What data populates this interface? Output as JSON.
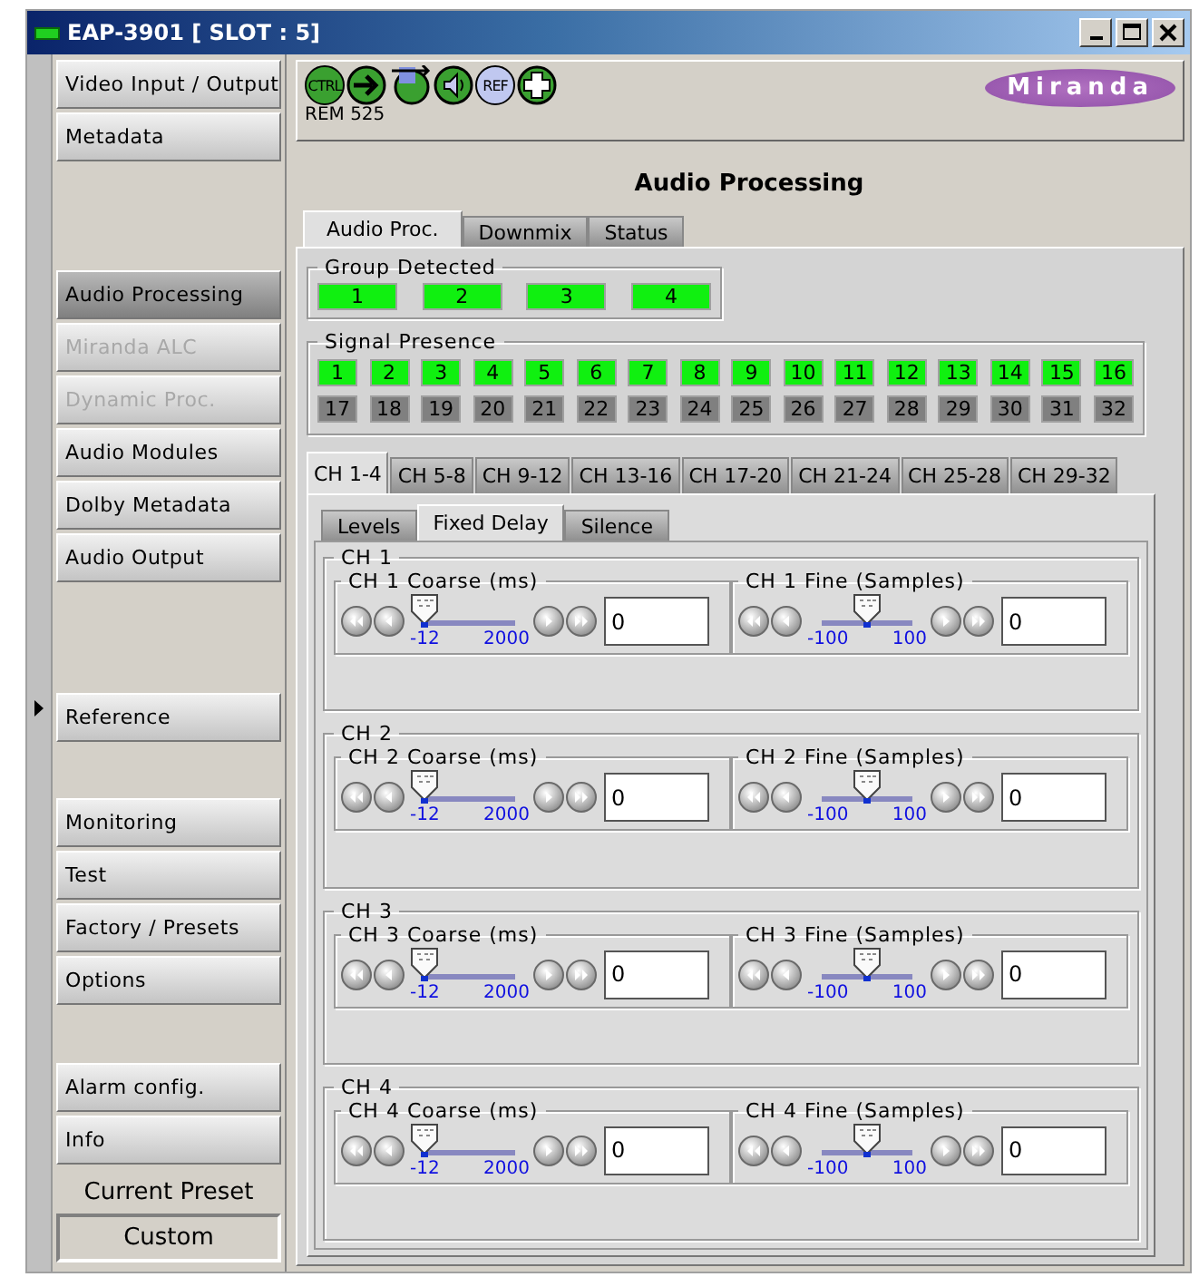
{
  "window": {
    "title": "EAP-3901 [ SLOT : 5]"
  },
  "toolbar": {
    "icons": [
      {
        "kind": "ctrl",
        "label": "CTRL"
      },
      {
        "kind": "arrow"
      },
      {
        "kind": "route"
      },
      {
        "kind": "speaker"
      },
      {
        "kind": "ref",
        "label": "REF"
      },
      {
        "kind": "plus"
      }
    ],
    "status": "REM 525",
    "logo": "Miranda"
  },
  "sidebar": {
    "groups": [
      [
        {
          "label": "Video Input / Output",
          "selected": false,
          "disabled": false
        },
        {
          "label": "Metadata",
          "selected": false,
          "disabled": false
        }
      ],
      [
        {
          "label": "Audio Processing",
          "selected": true,
          "disabled": false
        },
        {
          "label": "Miranda ALC",
          "selected": false,
          "disabled": true
        },
        {
          "label": "Dynamic Proc.",
          "selected": false,
          "disabled": true
        },
        {
          "label": "Audio Modules",
          "selected": false,
          "disabled": false
        },
        {
          "label": "Dolby Metadata",
          "selected": false,
          "disabled": false
        },
        {
          "label": "Audio Output",
          "selected": false,
          "disabled": false
        }
      ],
      [
        {
          "label": "Reference",
          "selected": false,
          "disabled": false
        }
      ],
      [
        {
          "label": "Monitoring",
          "selected": false,
          "disabled": false
        },
        {
          "label": "Test",
          "selected": false,
          "disabled": false
        },
        {
          "label": "Factory / Presets",
          "selected": false,
          "disabled": false
        },
        {
          "label": "Options",
          "selected": false,
          "disabled": false
        }
      ],
      [
        {
          "label": "Alarm config.",
          "selected": false,
          "disabled": false
        },
        {
          "label": "Info",
          "selected": false,
          "disabled": false
        }
      ]
    ],
    "preset_label": "Current Preset",
    "preset_value": "Custom"
  },
  "page_title": "Audio Processing",
  "tabs": [
    {
      "label": "Audio Proc.",
      "selected": true
    },
    {
      "label": "Downmix",
      "selected": false
    },
    {
      "label": "Status",
      "selected": false
    }
  ],
  "group_detected": {
    "title": "Group Detected",
    "items": [
      {
        "label": "1",
        "on": true
      },
      {
        "label": "2",
        "on": true
      },
      {
        "label": "3",
        "on": true
      },
      {
        "label": "4",
        "on": true
      }
    ]
  },
  "signal_presence": {
    "title": "Signal Presence",
    "items": [
      {
        "label": "1",
        "on": true
      },
      {
        "label": "2",
        "on": true
      },
      {
        "label": "3",
        "on": true
      },
      {
        "label": "4",
        "on": true
      },
      {
        "label": "5",
        "on": true
      },
      {
        "label": "6",
        "on": true
      },
      {
        "label": "7",
        "on": true
      },
      {
        "label": "8",
        "on": true
      },
      {
        "label": "9",
        "on": true
      },
      {
        "label": "10",
        "on": true
      },
      {
        "label": "11",
        "on": true
      },
      {
        "label": "12",
        "on": true
      },
      {
        "label": "13",
        "on": true
      },
      {
        "label": "14",
        "on": true
      },
      {
        "label": "15",
        "on": true
      },
      {
        "label": "16",
        "on": true
      },
      {
        "label": "17",
        "on": false
      },
      {
        "label": "18",
        "on": false
      },
      {
        "label": "19",
        "on": false
      },
      {
        "label": "20",
        "on": false
      },
      {
        "label": "21",
        "on": false
      },
      {
        "label": "22",
        "on": false
      },
      {
        "label": "23",
        "on": false
      },
      {
        "label": "24",
        "on": false
      },
      {
        "label": "25",
        "on": false
      },
      {
        "label": "26",
        "on": false
      },
      {
        "label": "27",
        "on": false
      },
      {
        "label": "28",
        "on": false
      },
      {
        "label": "29",
        "on": false
      },
      {
        "label": "30",
        "on": false
      },
      {
        "label": "31",
        "on": false
      },
      {
        "label": "32",
        "on": false
      }
    ]
  },
  "channel_tabs": [
    {
      "label": "CH 1-4",
      "selected": true
    },
    {
      "label": "CH 5-8",
      "selected": false
    },
    {
      "label": "CH 9-12",
      "selected": false
    },
    {
      "label": "CH 13-16",
      "selected": false
    },
    {
      "label": "CH 17-20",
      "selected": false
    },
    {
      "label": "CH 21-24",
      "selected": false
    },
    {
      "label": "CH 25-28",
      "selected": false
    },
    {
      "label": "CH 29-32",
      "selected": false
    }
  ],
  "sub_tabs": [
    {
      "label": "Levels",
      "selected": false
    },
    {
      "label": "Fixed Delay",
      "selected": true
    },
    {
      "label": "Silence",
      "selected": false
    }
  ],
  "channels": [
    {
      "title": "CH 1",
      "coarse": {
        "title": "CH 1 Coarse (ms)",
        "min": "-12",
        "max": "2000",
        "level": 0.006,
        "value": "0"
      },
      "fine": {
        "title": "CH 1 Fine (Samples)",
        "min": "-100",
        "max": "100",
        "level": 0.5,
        "value": "0"
      }
    },
    {
      "title": "CH 2",
      "coarse": {
        "title": "CH 2 Coarse (ms)",
        "min": "-12",
        "max": "2000",
        "level": 0.006,
        "value": "0"
      },
      "fine": {
        "title": "CH 2 Fine (Samples)",
        "min": "-100",
        "max": "100",
        "level": 0.5,
        "value": "0"
      }
    },
    {
      "title": "CH 3",
      "coarse": {
        "title": "CH 3 Coarse (ms)",
        "min": "-12",
        "max": "2000",
        "level": 0.006,
        "value": "0"
      },
      "fine": {
        "title": "CH 3 Fine (Samples)",
        "min": "-100",
        "max": "100",
        "level": 0.5,
        "value": "0"
      }
    },
    {
      "title": "CH 4",
      "coarse": {
        "title": "CH 4 Coarse (ms)",
        "min": "-12",
        "max": "2000",
        "level": 0.006,
        "value": "0"
      },
      "fine": {
        "title": "CH 4 Fine (Samples)",
        "min": "-100",
        "max": "100",
        "level": 0.5,
        "value": "0"
      }
    }
  ]
}
